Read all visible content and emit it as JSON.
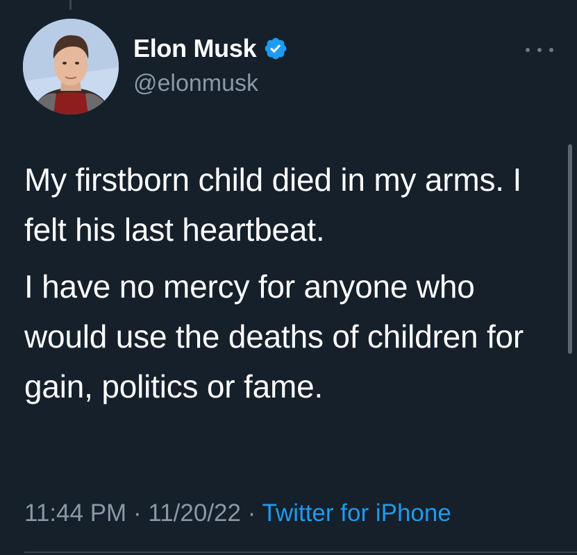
{
  "author": {
    "display_name": "Elon Musk",
    "handle": "@elonmusk",
    "verified": true,
    "verified_icon": "verified-badge-icon",
    "verified_color": "#1d9bf0"
  },
  "tweet": {
    "paragraphs": [
      "My firstborn child died in my arms. I felt his last heartbeat.",
      "I have no mercy for anyone who would use the deaths of children for gain, politics or fame."
    ]
  },
  "meta": {
    "time": "11:44 PM",
    "separator": " · ",
    "date": "11/20/22",
    "source": "Twitter for iPhone"
  },
  "colors": {
    "background": "#15202b",
    "text_primary": "#ffffff",
    "text_secondary": "#8b98a5",
    "accent": "#1d9bf0"
  }
}
